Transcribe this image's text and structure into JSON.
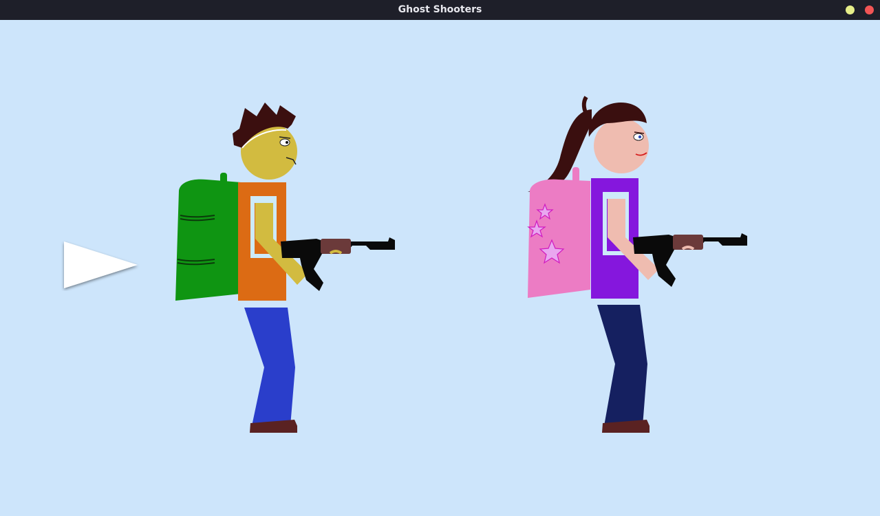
{
  "window": {
    "title": "Ghost Shooters",
    "buttons": {
      "minimize_color": "#e6ee8a",
      "close_color": "#f25555"
    }
  },
  "scene": {
    "background": "#cde5fb",
    "selector_arrow": {
      "icon": "play-arrow-icon",
      "color": "#ffffff",
      "target": "character-boy"
    },
    "characters": [
      {
        "id": "boy",
        "skin": "#d2bb40",
        "hair": "#3b0f0f",
        "shirt": "#dc6b14",
        "shirt_panel": "#cdeaf9",
        "backpack": "#0f9512",
        "pants": "#2a3ecb",
        "shoes": "#5a2222",
        "rifle": "#0a0a0a",
        "rifle_grip": "#6b3a3a"
      },
      {
        "id": "girl",
        "skin": "#efbcb0",
        "hair": "#3a0f0f",
        "shirt": "#8517dd",
        "shirt_panel": "#cdeaf9",
        "backpack": "#ec7cc4",
        "backpack_stars": "#e9a7f0",
        "pants": "#152060",
        "shoes": "#5a2222",
        "rifle": "#0a0a0a",
        "rifle_grip": "#6b3a3a"
      }
    ]
  }
}
